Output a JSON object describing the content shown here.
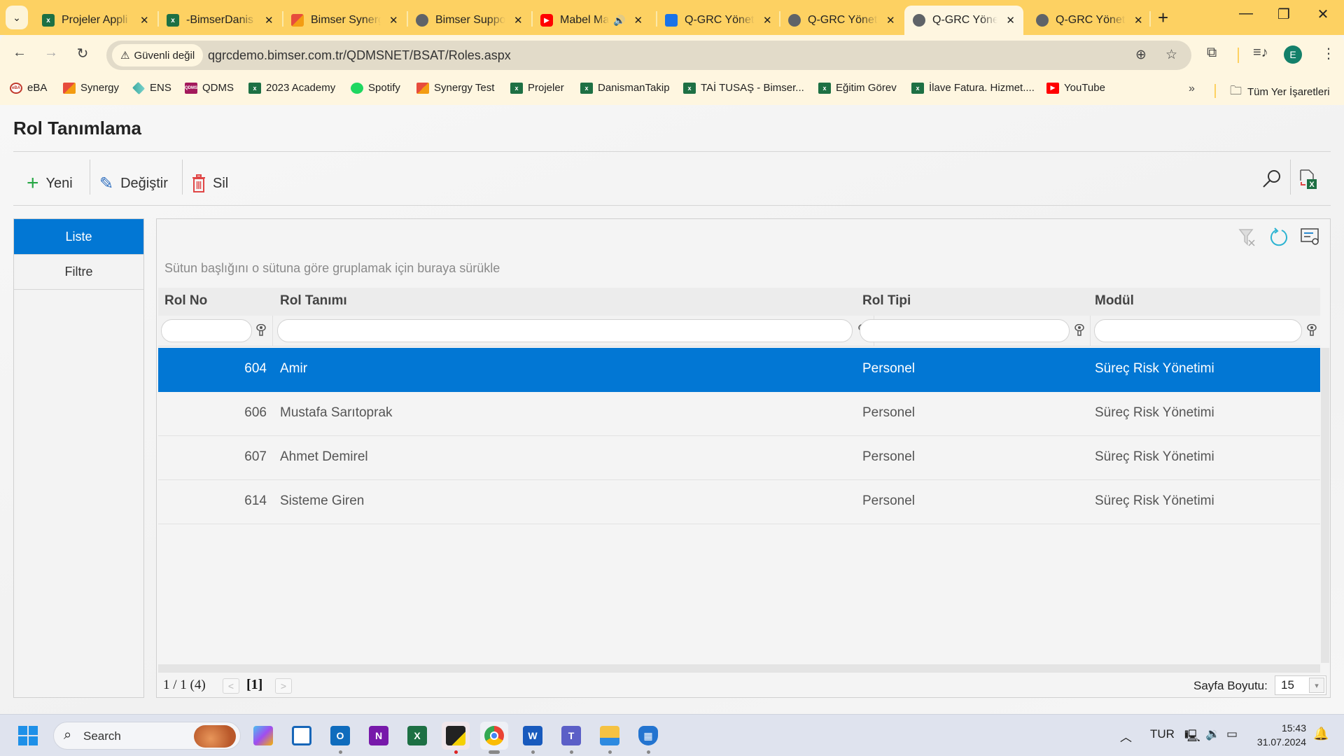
{
  "browser": {
    "tabs": [
      {
        "title": "Projeler Appli",
        "icon": "excel-icon",
        "active": false
      },
      {
        "title": "-BimserDanis",
        "icon": "excel-icon",
        "active": false
      },
      {
        "title": "Bimser Synerg",
        "icon": "synergy-icon",
        "active": false
      },
      {
        "title": "Bimser Suppo",
        "icon": "globe-icon",
        "active": false
      },
      {
        "title": "Mabel Ma",
        "icon": "youtube-icon",
        "active": false,
        "audio": true
      },
      {
        "title": "Q-GRC Yöneti",
        "icon": "qgrc-icon",
        "active": false
      },
      {
        "title": "Q-GRC Yönet",
        "icon": "globe-icon",
        "active": false
      },
      {
        "title": "Q-GRC Yöneti",
        "icon": "globe-icon",
        "active": true
      },
      {
        "title": "Q-GRC Yönet",
        "icon": "globe-icon",
        "active": false
      }
    ],
    "security_label": "Güvenli değil",
    "url": "qgrcdemo.bimser.com.tr/QDMSNET/BSAT/Roles.aspx",
    "profile_initial": "E",
    "bookmarks": [
      {
        "label": "eBA",
        "icon": "eba-icon"
      },
      {
        "label": "Synergy",
        "icon": "synergy-icon"
      },
      {
        "label": "ENS",
        "icon": "ens-icon"
      },
      {
        "label": "QDMS",
        "icon": "qdms-icon"
      },
      {
        "label": "2023 Academy",
        "icon": "excel-icon"
      },
      {
        "label": "Spotify",
        "icon": "spotify-icon"
      },
      {
        "label": "Synergy Test",
        "icon": "synergy-icon"
      },
      {
        "label": "Projeler",
        "icon": "excel-icon"
      },
      {
        "label": "DanismanTakip",
        "icon": "excel-icon"
      },
      {
        "label": "TAİ TUSAŞ - Bimser...",
        "icon": "excel-icon"
      },
      {
        "label": "Eğitim Görev",
        "icon": "excel-icon"
      },
      {
        "label": "İlave Fatura. Hizmet....",
        "icon": "excel-icon"
      },
      {
        "label": "YouTube",
        "icon": "youtube-icon"
      }
    ],
    "all_bookmarks_label": "Tüm Yer İşaretleri"
  },
  "page": {
    "title": "Rol Tanımlama",
    "actions": {
      "new_label": "Yeni",
      "edit_label": "Değiştir",
      "delete_label": "Sil"
    },
    "side_tabs": [
      {
        "label": "Liste",
        "active": true
      },
      {
        "label": "Filtre",
        "active": false
      }
    ],
    "grid": {
      "group_hint": "Sütun başlığını o sütuna göre gruplamak için buraya sürükle",
      "columns": [
        "Rol No",
        "Rol Tanımı",
        "Rol Tipi",
        "Modül"
      ],
      "filter_values": [
        "",
        "",
        "",
        ""
      ],
      "rows": [
        {
          "no": "604",
          "name": "Amir",
          "type": "Personel",
          "module": "Süreç Risk Yönetimi",
          "selected": true
        },
        {
          "no": "606",
          "name": "Mustafa Sarıtoprak",
          "type": "Personel",
          "module": "Süreç Risk Yönetimi",
          "selected": false
        },
        {
          "no": "607",
          "name": "Ahmet Demirel",
          "type": "Personel",
          "module": "Süreç Risk Yönetimi",
          "selected": false
        },
        {
          "no": "614",
          "name": "Sisteme Giren",
          "type": "Personel",
          "module": "Süreç Risk Yönetimi",
          "selected": false
        }
      ],
      "pager": {
        "summary": "1 / 1 (4)",
        "current_page": "[1]",
        "page_size_label": "Sayfa Boyutu:",
        "page_size": "15"
      }
    },
    "colors": {
      "accent": "#0277d4",
      "tabstrip": "#fdd162",
      "toolbar": "#fef6e0"
    }
  },
  "taskbar": {
    "search_label": "Search",
    "language": "TUR",
    "time": "15:43",
    "date": "31.07.2024"
  }
}
